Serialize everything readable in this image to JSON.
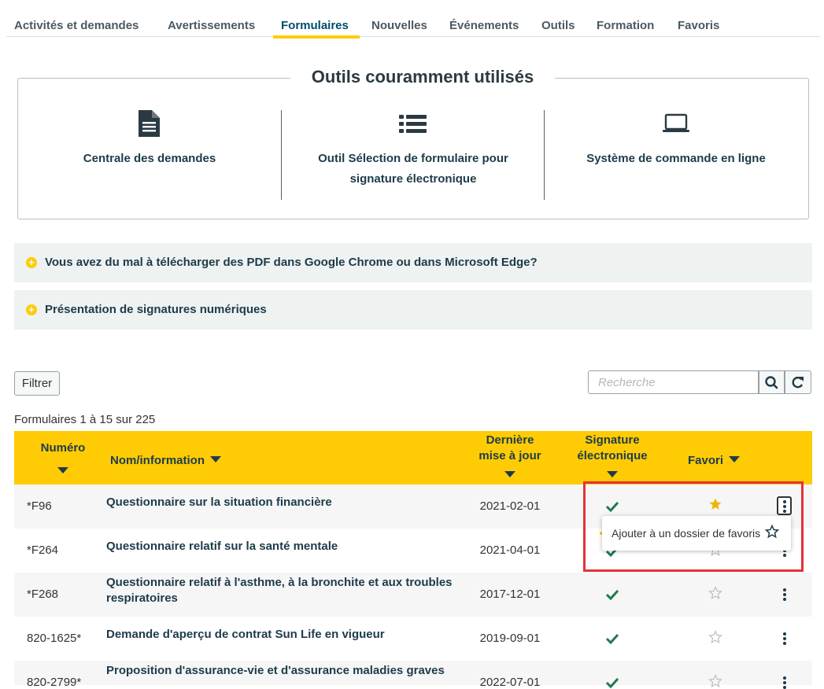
{
  "tabs": [
    {
      "label": "Activités et demandes"
    },
    {
      "label": "Avertissements"
    },
    {
      "label": "Formulaires",
      "active": true
    },
    {
      "label": "Nouvelles"
    },
    {
      "label": "Événements"
    },
    {
      "label": "Outils"
    },
    {
      "label": "Formation"
    },
    {
      "label": "Favoris"
    }
  ],
  "tools": {
    "title": "Outils couramment utilisés",
    "items": [
      {
        "label": "Centrale des demandes",
        "icon": "document-icon"
      },
      {
        "label": "Outil Sélection de formulaire pour signature électronique",
        "icon": "list-icon"
      },
      {
        "label": "Système de commande en ligne",
        "icon": "laptop-icon"
      }
    ]
  },
  "accordions": [
    {
      "label": "Vous avez du mal à télécharger des PDF dans Google Chrome ou dans Microsoft Edge?"
    },
    {
      "label": "Présentation de signatures numériques"
    }
  ],
  "filter_label": "Filtrer",
  "search": {
    "placeholder": "Recherche"
  },
  "count_text": "Formulaires 1 à 15 sur 225",
  "table": {
    "headers": {
      "number": "Numéro",
      "name": "Nom/information",
      "date_line1": "Dernière",
      "date_line2": "mise à jour",
      "sig_line1": "Signature",
      "sig_line2": "électronique",
      "fav": "Favori"
    },
    "rows": [
      {
        "number": "*F96",
        "name": "Questionnaire sur la situation financière",
        "date": "2021-02-01",
        "esign": true,
        "favorite": true
      },
      {
        "number": "*F264",
        "name": "Questionnaire relatif sur la santé mentale",
        "date": "2021-04-01",
        "esign": true,
        "favorite": false
      },
      {
        "number": "*F268",
        "name": "Questionnaire relatif à l'asthme, à la bronchite et aux troubles respiratoires",
        "date": "2017-12-01",
        "esign": true,
        "favorite": false
      },
      {
        "number": "820-1625*",
        "name": "Demande d'aperçu de contrat Sun Life en vigueur",
        "date": "2019-09-01",
        "esign": true,
        "favorite": false
      },
      {
        "number": "820-2799*",
        "name": "Proposition d'assurance-vie et d'assurance maladies graves",
        "date": "2022-07-01",
        "esign": true,
        "favorite": false
      }
    ]
  },
  "popup": {
    "label": "Ajouter à un dossier de favoris"
  },
  "colors": {
    "accent": "#ffcb05",
    "text_dark": "#1d3b4a",
    "check": "#1f7a4d",
    "highlight": "#e3323b"
  }
}
